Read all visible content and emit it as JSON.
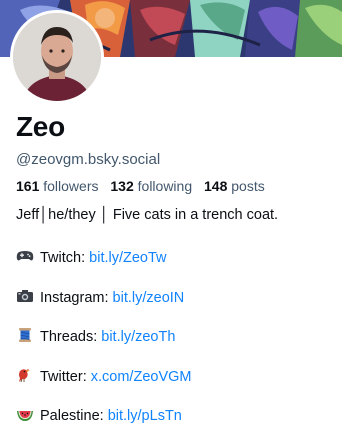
{
  "profile": {
    "display_name": "Zeo",
    "handle": "@zeovgm.bsky.social",
    "stats": {
      "followers_count": "161",
      "followers_label": "followers",
      "following_count": "132",
      "following_label": "following",
      "posts_count": "148",
      "posts_label": "posts"
    },
    "bio": {
      "intro": "Jeff│he/they │ Five cats in a trench coat.",
      "links": [
        {
          "icon": "gamepad-icon",
          "label": "Twitch:",
          "url": "bit.ly/ZeoTw"
        },
        {
          "icon": "camera-icon",
          "label": "Instagram:",
          "url": "bit.ly/zeoIN"
        },
        {
          "icon": "thread-spool-icon",
          "label": "Threads:",
          "url": "bit.ly/zeoTh"
        },
        {
          "icon": "bird-icon",
          "label": "Twitter:",
          "url": "x.com/ZeoVGM"
        },
        {
          "icon": "watermelon-icon",
          "label": "Palestine:",
          "url": "bit.ly/pLsTn"
        }
      ]
    }
  },
  "colors": {
    "link": "#1083fe",
    "secondary_text": "#42576c",
    "primary_text": "#0b0f14"
  }
}
